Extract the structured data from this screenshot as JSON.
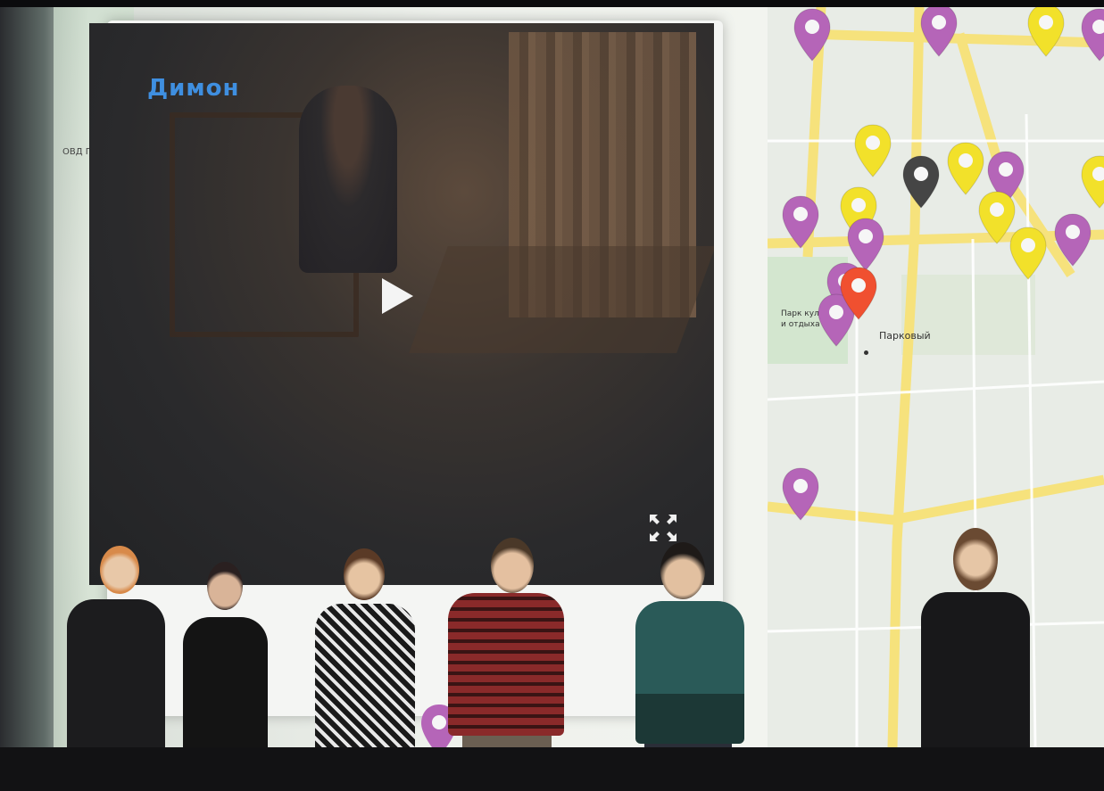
{
  "video": {
    "title": "Димон",
    "subtitle": "",
    "play_icon": "play-icon",
    "fullscreen_icon": "fullscreen-icon"
  },
  "map": {
    "label_park": "Парк культуры и отдыха",
    "label_parkovy": "Парковый",
    "left_poi_label": "ОВД Петр",
    "colors": {
      "purple": "#b565b8",
      "yellow": "#f2e12a",
      "red": "#f05030",
      "dark": "#454545",
      "road": "#f7e37a"
    }
  },
  "pins": [
    {
      "color": "purple"
    },
    {
      "color": "purple"
    },
    {
      "color": "yellow"
    },
    {
      "color": "yellow"
    },
    {
      "color": "yellow"
    },
    {
      "color": "dark"
    },
    {
      "color": "yellow"
    },
    {
      "color": "purple"
    },
    {
      "color": "purple"
    },
    {
      "color": "purple"
    },
    {
      "color": "yellow"
    },
    {
      "color": "yellow"
    },
    {
      "color": "yellow"
    },
    {
      "color": "purple"
    },
    {
      "color": "purple"
    },
    {
      "color": "purple"
    },
    {
      "color": "red"
    },
    {
      "color": "purple"
    },
    {
      "color": "purple"
    }
  ]
}
